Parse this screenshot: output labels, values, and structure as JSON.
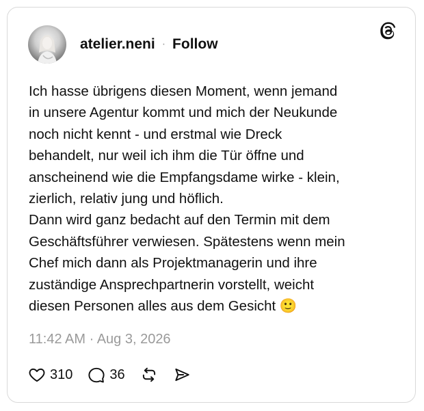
{
  "post": {
    "author": {
      "username": "atelier.neni",
      "follow_label": "Follow"
    },
    "separator": "·",
    "text": "Ich hasse übrigens diesen Moment, wenn jemand\nin unsere Agentur kommt und mich der Neukunde\nnoch nicht kennt - und erstmal wie Dreck\nbehandelt, nur weil ich ihm die Tür öffne und\nanscheinend wie die Empfangsdame wirke - klein,\nzierlich, relativ jung und höflich.\nDann wird ganz bedacht auf den Termin mit dem\nGeschäftsführer verwiesen. Spätestens wenn mein\nChef mich dann als Projektmanagerin und ihre\nzuständige Ansprechpartnerin vorstellt, weicht\ndiesen Personen alles aus dem Gesicht 🙂",
    "timestamp": "11:42 AM · Aug 3, 2026",
    "likes": "310",
    "replies": "36"
  },
  "icons": {
    "brand": "threads-logo-icon",
    "like": "heart-icon",
    "reply": "comment-bubble-icon",
    "repost": "repost-arrows-icon",
    "share": "send-arrow-icon"
  },
  "colors": {
    "text": "#101010",
    "muted": "#9a9a9a",
    "border": "#d9d9d9"
  }
}
